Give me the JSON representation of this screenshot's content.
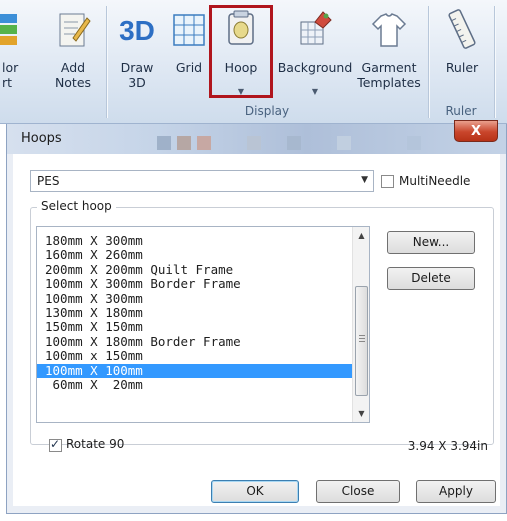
{
  "ribbon": {
    "buttons": [
      {
        "label": "lor\nrt",
        "icon": "color-sort-icon"
      },
      {
        "label": "Add\nNotes",
        "icon": "notes-icon"
      },
      {
        "label": "Draw\n3D",
        "icon": "3d-icon"
      },
      {
        "label": "Grid",
        "icon": "grid-icon"
      },
      {
        "label": "Hoop",
        "icon": "hoop-icon"
      },
      {
        "label": "Background",
        "icon": "background-icon"
      },
      {
        "label": "Garment\nTemplates",
        "icon": "garment-icon"
      },
      {
        "label": "Ruler",
        "icon": "ruler-icon"
      }
    ],
    "groups": {
      "display": "Display",
      "ruler": "Ruler"
    },
    "highlight_color": "#b0151d"
  },
  "dialog": {
    "title": "Hoops",
    "close_label": "X",
    "format": {
      "value": "PES"
    },
    "multineedle": {
      "label": "MultiNeedle",
      "checked": false
    },
    "select_hoop_label": "Select hoop",
    "hoops": [
      "180mm X 300mm",
      "160mm X 260mm",
      "200mm X 200mm Quilt Frame",
      "100mm X 300mm Border Frame",
      "100mm X 300mm",
      "130mm X 180mm",
      "150mm X 150mm",
      "100mm X 180mm Border Frame",
      "100mm x 150mm",
      "100mm X 100mm",
      " 60mm X  20mm"
    ],
    "selected_hoop_index": 9,
    "selection_color": "#3399ff",
    "buttons": {
      "new": "New...",
      "delete": "Delete",
      "ok": "OK",
      "close": "Close",
      "apply": "Apply"
    },
    "rotate": {
      "label": "Rotate 90",
      "checked": true
    },
    "size_readout": "3.94 X 3.94in"
  }
}
